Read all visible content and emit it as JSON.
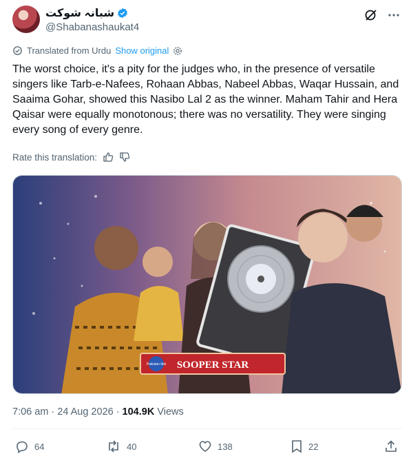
{
  "author": {
    "display_name": "شبانہ شوکت",
    "handle": "@Shabanashaukat4"
  },
  "translation": {
    "label": "Translated from Urdu",
    "show_original": "Show original"
  },
  "tweet_text": "The worst choice, it's a pity for the judges who, in the presence of versatile singers like Tarb-e-Nafees, Rohaan Abbas, Nabeel Abbas, Waqar Hussain, and Saaima Gohar, showed this Nasibo Lal 2 as the winner. Maham Tahir and Hera Qaisar were equally monotonous; there was no versatility. They were singing every song of every genre.",
  "rate_translation": "Rate this translation:",
  "media": {
    "banner_text": "SOOPER STAR",
    "badge_text": "Pakistan Idol"
  },
  "meta": {
    "time": "7:06 am",
    "separator": "·",
    "date": "24 Aug 2026",
    "views_count": "104.9K",
    "views_label": "Views"
  },
  "actions": {
    "replies": "64",
    "reposts": "40",
    "likes": "138",
    "bookmarks": "22"
  },
  "colors": {
    "accent": "#1d9bf0",
    "secondary_text": "#536471",
    "banner": "#c0262b"
  }
}
